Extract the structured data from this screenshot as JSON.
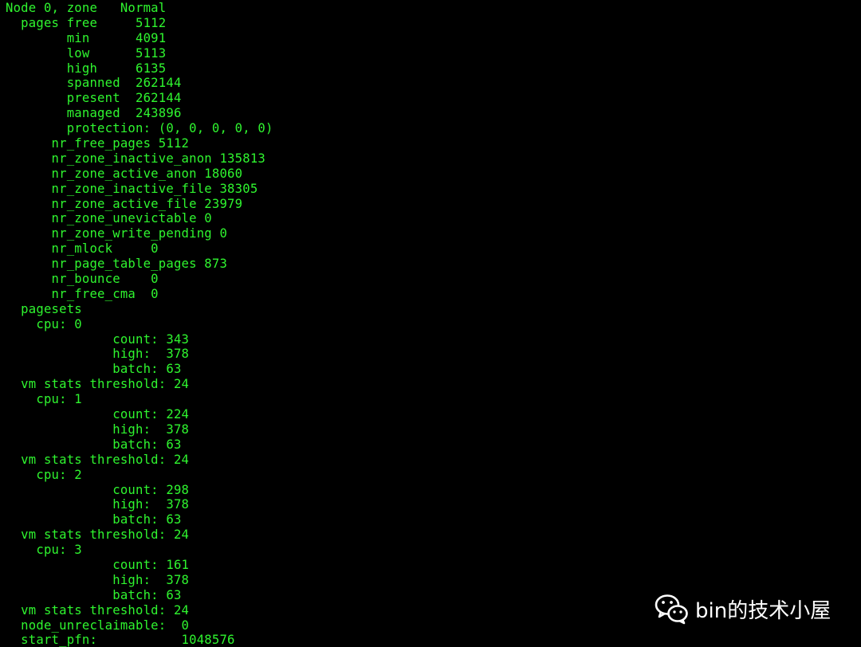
{
  "terminal": {
    "text_color": "#2ff52f",
    "background": "#000000",
    "lines": [
      "Node 0, zone   Normal",
      "  pages free     5112",
      "        min      4091",
      "        low      5113",
      "        high     6135",
      "        spanned  262144",
      "        present  262144",
      "        managed  243896",
      "        protection: (0, 0, 0, 0, 0)",
      "      nr_free_pages 5112",
      "      nr_zone_inactive_anon 135813",
      "      nr_zone_active_anon 18060",
      "      nr_zone_inactive_file 38305",
      "      nr_zone_active_file 23979",
      "      nr_zone_unevictable 0",
      "      nr_zone_write_pending 0",
      "      nr_mlock     0",
      "      nr_page_table_pages 873",
      "      nr_bounce    0",
      "      nr_free_cma  0",
      "  pagesets",
      "    cpu: 0",
      "              count: 343",
      "              high:  378",
      "              batch: 63",
      "  vm stats threshold: 24",
      "    cpu: 1",
      "              count: 224",
      "              high:  378",
      "              batch: 63",
      "  vm stats threshold: 24",
      "    cpu: 2",
      "              count: 298",
      "              high:  378",
      "              batch: 63",
      "  vm stats threshold: 24",
      "    cpu: 3",
      "              count: 161",
      "              high:  378",
      "              batch: 63",
      "  vm stats threshold: 24",
      "  node_unreclaimable:  0",
      "  start_pfn:           1048576"
    ]
  },
  "watermark": {
    "icon": "wechat-icon",
    "text": "bin的技术小屋"
  }
}
